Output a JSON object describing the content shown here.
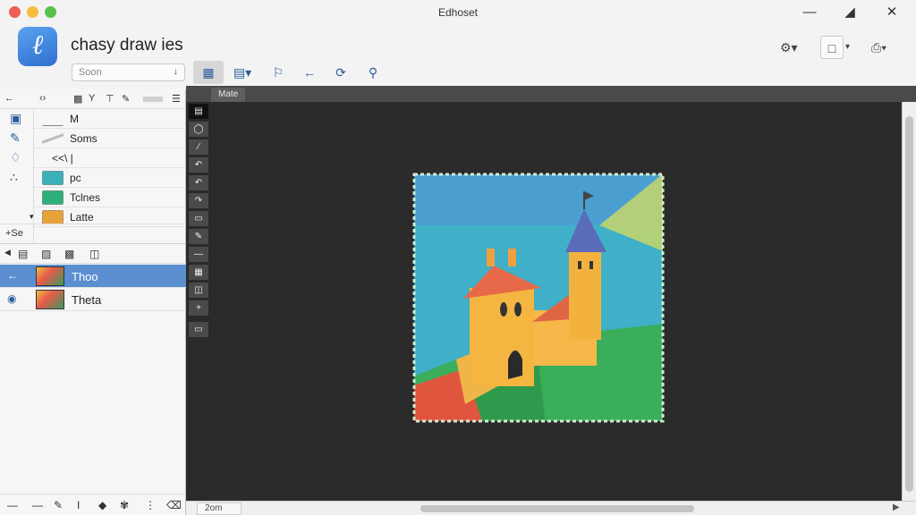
{
  "window": {
    "title": "Edhoset"
  },
  "app": {
    "name": "chasy draw ies",
    "icon": "app-logo-icon"
  },
  "search": {
    "value": "Soon"
  },
  "toolbar": {
    "buttons": [
      "grid-icon",
      "layout-icon",
      "transform-icon",
      "back-arrow-icon",
      "lasso-icon",
      "zoom-icon"
    ]
  },
  "right_toolbar": {
    "buttons": [
      "settings-icon",
      "frame-icon",
      "export-icon"
    ]
  },
  "brushes": {
    "items": [
      {
        "label": "M"
      },
      {
        "label": "Soms"
      },
      {
        "label": "<<\\  |"
      },
      {
        "label": "pc"
      },
      {
        "label": "Tclnes"
      },
      {
        "label": "Latte"
      }
    ],
    "section_label": "+Se"
  },
  "layers": {
    "items": [
      {
        "label": "Thoo",
        "selected": true
      },
      {
        "label": "Theta",
        "selected": false
      }
    ]
  },
  "canvas": {
    "tab_label": "Mate",
    "zoom": "2om"
  },
  "colors": {
    "accent": "#5b8fd0",
    "canvas_bg": "#2b2b2b"
  }
}
